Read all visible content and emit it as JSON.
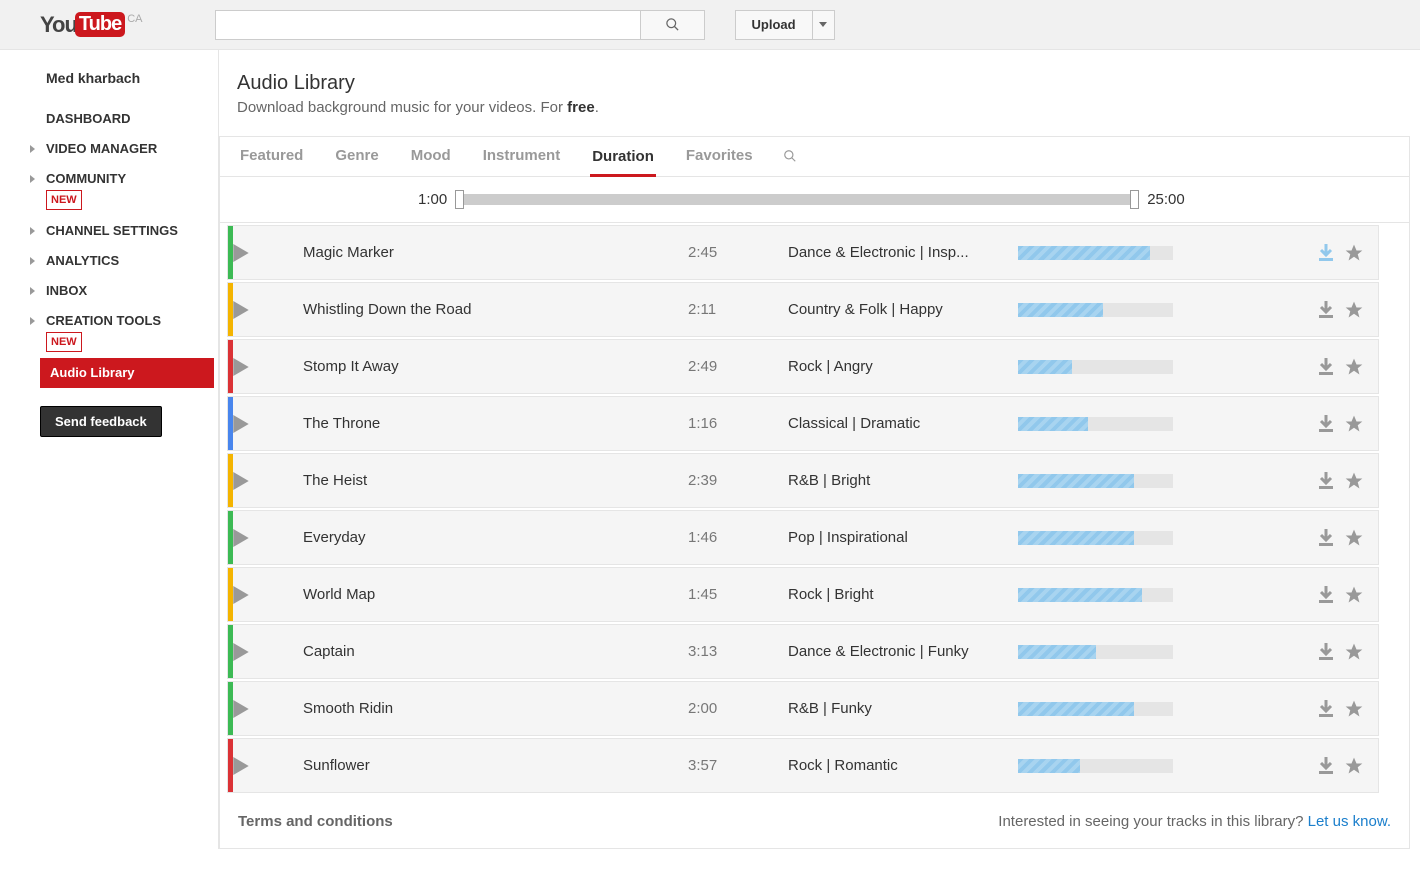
{
  "header": {
    "logo_you": "You",
    "logo_tube": "Tube",
    "region": "CA",
    "upload": "Upload"
  },
  "sidebar": {
    "user": "Med kharbach",
    "items": [
      {
        "label": "DASHBOARD"
      },
      {
        "label": "VIDEO MANAGER",
        "arrow": true
      },
      {
        "label": "COMMUNITY",
        "arrow": true,
        "badge": "NEW"
      },
      {
        "label": "CHANNEL SETTINGS",
        "arrow": true
      },
      {
        "label": "ANALYTICS",
        "arrow": true
      },
      {
        "label": "INBOX",
        "arrow": true
      },
      {
        "label": "CREATION TOOLS",
        "arrow": true,
        "badge": "NEW"
      },
      {
        "label": "Audio Library",
        "active": true
      }
    ],
    "feedback": "Send feedback"
  },
  "page": {
    "title": "Audio Library",
    "subtitle_pre": "Download background music for your videos. For ",
    "subtitle_bold": "free",
    "subtitle_post": "."
  },
  "tabs": [
    {
      "label": "Featured"
    },
    {
      "label": "Genre"
    },
    {
      "label": "Mood"
    },
    {
      "label": "Instrument"
    },
    {
      "label": "Duration",
      "active": true
    },
    {
      "label": "Favorites"
    }
  ],
  "slider": {
    "min": "1:00",
    "max": "25:00"
  },
  "tracks": [
    {
      "title": "Magic Marker",
      "duration": "2:45",
      "genre": "Dance & Electronic | Insp...",
      "color": "green",
      "progress": 85,
      "highlight": true
    },
    {
      "title": "Whistling Down the Road",
      "duration": "2:11",
      "genre": "Country & Folk | Happy",
      "color": "orange",
      "progress": 55
    },
    {
      "title": "Stomp It Away",
      "duration": "2:49",
      "genre": "Rock | Angry",
      "color": "red",
      "progress": 35
    },
    {
      "title": "The Throne",
      "duration": "1:16",
      "genre": "Classical | Dramatic",
      "color": "blue",
      "progress": 45
    },
    {
      "title": "The Heist",
      "duration": "2:39",
      "genre": "R&B | Bright",
      "color": "orange",
      "progress": 75
    },
    {
      "title": "Everyday",
      "duration": "1:46",
      "genre": "Pop | Inspirational",
      "color": "green",
      "progress": 75
    },
    {
      "title": "World Map",
      "duration": "1:45",
      "genre": "Rock | Bright",
      "color": "orange",
      "progress": 80
    },
    {
      "title": "Captain",
      "duration": "3:13",
      "genre": "Dance & Electronic | Funky",
      "color": "green",
      "progress": 50
    },
    {
      "title": "Smooth Ridin",
      "duration": "2:00",
      "genre": "R&B | Funky",
      "color": "green",
      "progress": 75
    },
    {
      "title": "Sunflower",
      "duration": "3:57",
      "genre": "Rock | Romantic",
      "color": "red",
      "progress": 40
    }
  ],
  "footer": {
    "terms": "Terms and conditions",
    "cta_text": "Interested in seeing your tracks in this library? ",
    "cta_link": "Let us know."
  }
}
